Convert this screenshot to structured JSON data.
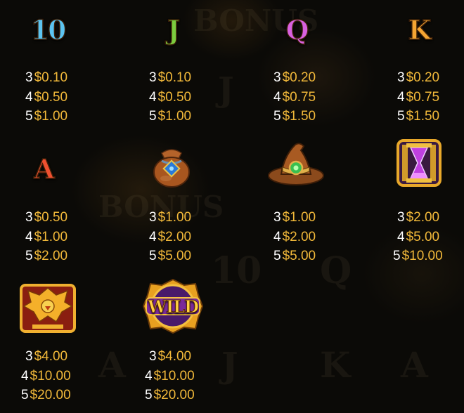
{
  "colors": {
    "amount": "#f2b93a",
    "count": "#ffffff",
    "background": "#0b0a07"
  },
  "symbols": [
    {
      "name": "ten",
      "label": "10",
      "color": "#4fb8e8",
      "pays": [
        {
          "count": "3",
          "amount": "$0.10"
        },
        {
          "count": "4",
          "amount": "$0.50"
        },
        {
          "count": "5",
          "amount": "$1.00"
        }
      ]
    },
    {
      "name": "jack",
      "label": "J",
      "color": "#6fbf3a",
      "pays": [
        {
          "count": "3",
          "amount": "$0.10"
        },
        {
          "count": "4",
          "amount": "$0.50"
        },
        {
          "count": "5",
          "amount": "$1.00"
        }
      ]
    },
    {
      "name": "queen",
      "label": "Q",
      "color": "#d05ad8",
      "pays": [
        {
          "count": "3",
          "amount": "$0.20"
        },
        {
          "count": "4",
          "amount": "$0.75"
        },
        {
          "count": "5",
          "amount": "$1.50"
        }
      ]
    },
    {
      "name": "king",
      "label": "K",
      "color": "#f0a030",
      "pays": [
        {
          "count": "3",
          "amount": "$0.20"
        },
        {
          "count": "4",
          "amount": "$0.75"
        },
        {
          "count": "5",
          "amount": "$1.50"
        }
      ]
    },
    {
      "name": "ace",
      "label": "A",
      "color": "#e84a30",
      "pays": [
        {
          "count": "3",
          "amount": "$0.50"
        },
        {
          "count": "4",
          "amount": "$1.00"
        },
        {
          "count": "5",
          "amount": "$2.00"
        }
      ]
    },
    {
      "name": "pouch",
      "icon": "magic-pouch-icon",
      "pays": [
        {
          "count": "3",
          "amount": "$1.00"
        },
        {
          "count": "4",
          "amount": "$2.00"
        },
        {
          "count": "5",
          "amount": "$5.00"
        }
      ]
    },
    {
      "name": "hat",
      "icon": "wizard-hat-icon",
      "pays": [
        {
          "count": "3",
          "amount": "$1.00"
        },
        {
          "count": "4",
          "amount": "$2.00"
        },
        {
          "count": "5",
          "amount": "$5.00"
        }
      ]
    },
    {
      "name": "hourglass",
      "icon": "hourglass-icon",
      "pays": [
        {
          "count": "3",
          "amount": "$2.00"
        },
        {
          "count": "4",
          "amount": "$5.00"
        },
        {
          "count": "5",
          "amount": "$10.00"
        }
      ]
    },
    {
      "name": "phoenix",
      "icon": "phoenix-icon",
      "pays": [
        {
          "count": "3",
          "amount": "$4.00"
        },
        {
          "count": "4",
          "amount": "$10.00"
        },
        {
          "count": "5",
          "amount": "$20.00"
        }
      ]
    },
    {
      "name": "wild",
      "label": "WILD",
      "icon": "wild-badge-icon",
      "pays": [
        {
          "count": "3",
          "amount": "$4.00"
        },
        {
          "count": "4",
          "amount": "$10.00"
        },
        {
          "count": "5",
          "amount": "$20.00"
        }
      ]
    }
  ]
}
